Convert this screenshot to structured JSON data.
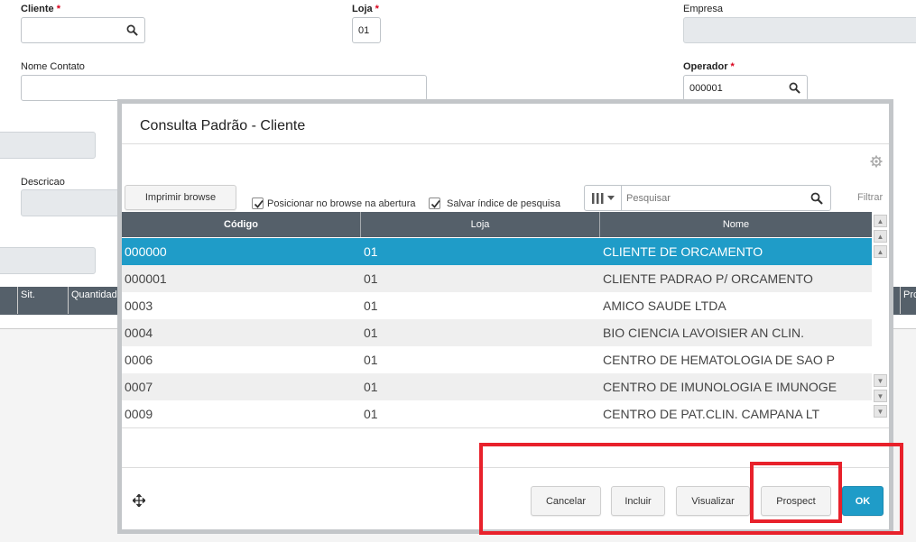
{
  "form": {
    "cliente_label": "Cliente",
    "cliente_value": "",
    "loja_label": "Loja",
    "loja_value": "01",
    "empresa_label": "Empresa",
    "empresa_value": "",
    "nome_contato_label": "Nome Contato",
    "nome_contato_value": "",
    "operador_label": "Operador",
    "operador_value": "000001",
    "descricao_label": "Descricao",
    "required_mark": "*"
  },
  "bg_grid": {
    "columns": [
      "Sit.",
      "Quantidade",
      "Prc"
    ]
  },
  "modal": {
    "title": "Consulta Padrão - Cliente",
    "print_button": "Imprimir browse",
    "checkbox1_label": "Posicionar no browse na abertura",
    "checkbox1_checked": true,
    "checkbox2_label": "Salvar índice de pesquisa",
    "checkbox2_checked": true,
    "search_placeholder": "Pesquisar",
    "filter_label": "Filtrar",
    "columns": {
      "codigo": "Código",
      "loja": "Loja",
      "nome": "Nome"
    },
    "rows": [
      {
        "codigo": "000000",
        "loja": "01",
        "nome": "CLIENTE DE ORCAMENTO"
      },
      {
        "codigo": "000001",
        "loja": "01",
        "nome": "CLIENTE PADRAO P/ ORCAMENTO"
      },
      {
        "codigo": "0003",
        "loja": "01",
        "nome": "AMICO SAUDE LTDA"
      },
      {
        "codigo": "0004",
        "loja": "01",
        "nome": "BIO CIENCIA LAVOISIER AN CLIN."
      },
      {
        "codigo": "0006",
        "loja": "01",
        "nome": "CENTRO DE HEMATOLOGIA DE SAO P"
      },
      {
        "codigo": "0007",
        "loja": "01",
        "nome": "CENTRO DE IMUNOLOGIA E IMUNOGE"
      },
      {
        "codigo": "0009",
        "loja": "01",
        "nome": "CENTRO DE PAT.CLIN. CAMPANA LT"
      }
    ],
    "selected_row": 0,
    "buttons": {
      "cancelar": "Cancelar",
      "incluir": "Incluir",
      "visualizar": "Visualizar",
      "prospect": "Prospect",
      "ok": "OK"
    }
  },
  "colors": {
    "accent": "#1f9cc8",
    "header": "#55606a",
    "highlight": "#e8212b"
  }
}
